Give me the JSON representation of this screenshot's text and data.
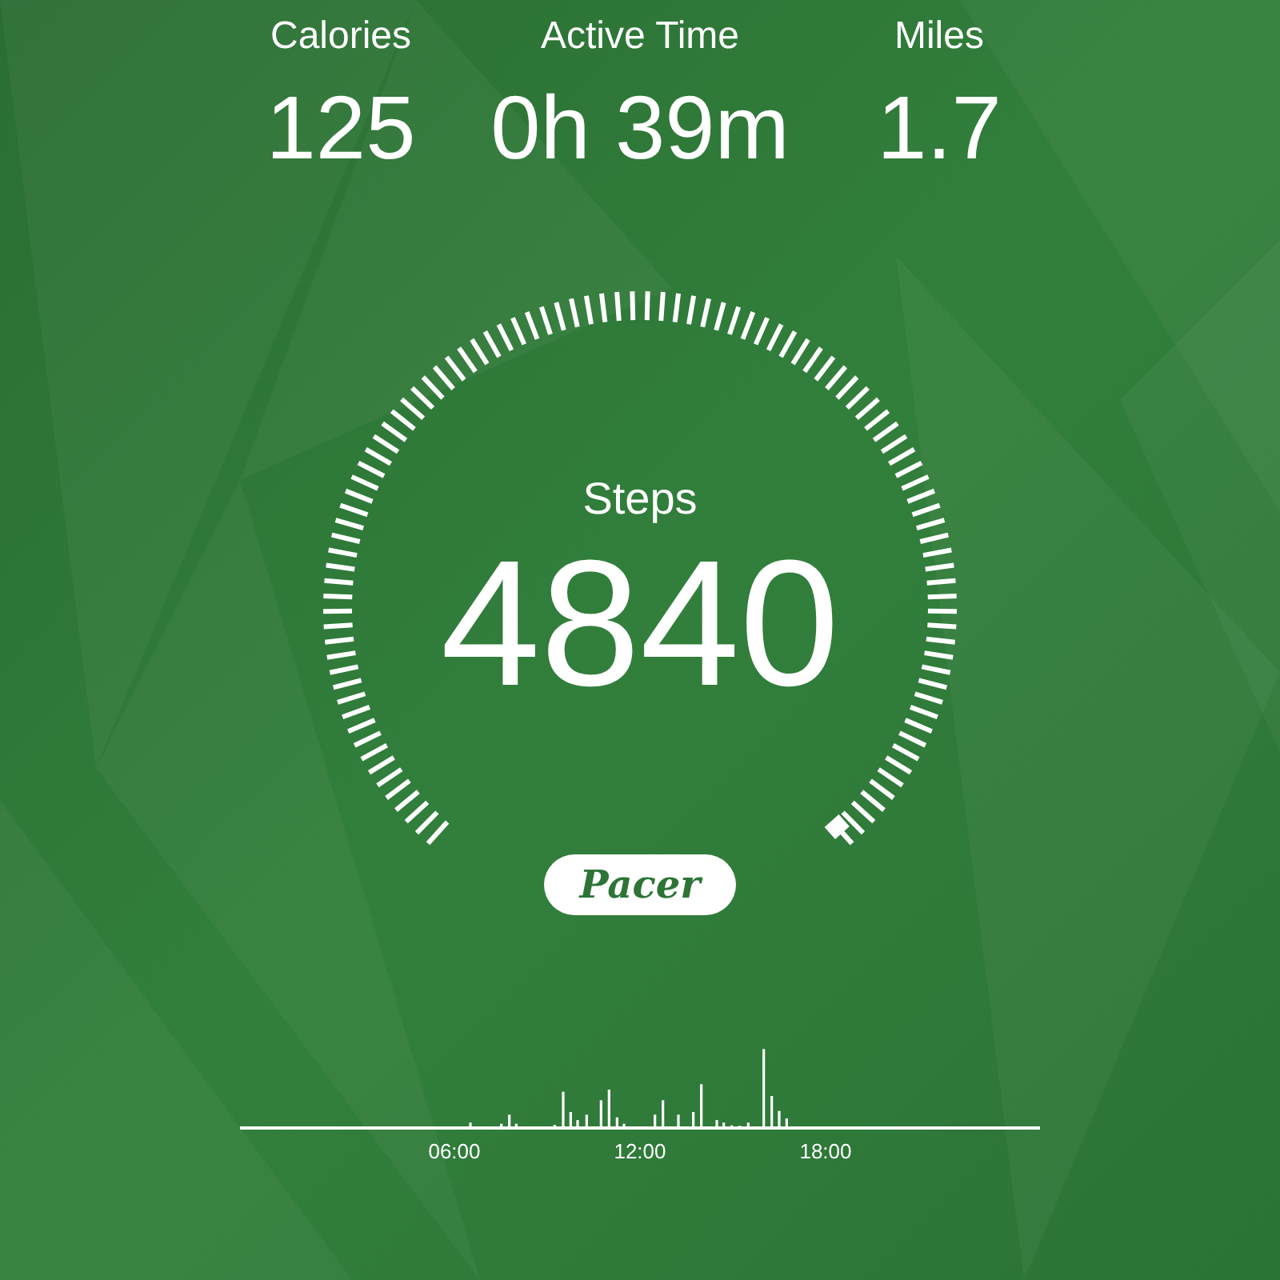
{
  "stats": [
    {
      "label": "Calories",
      "value": "125"
    },
    {
      "label": "Active Time",
      "value": "0h 39m"
    },
    {
      "label": "Miles",
      "value": "1.7"
    }
  ],
  "steps": {
    "label": "Steps",
    "value": "4840"
  },
  "logo": "Pacer",
  "timeline": {
    "labels": [
      "06:00",
      "12:00",
      "18:00"
    ]
  }
}
